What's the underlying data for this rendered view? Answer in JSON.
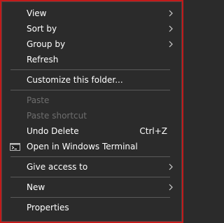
{
  "menu": {
    "view": "View",
    "sort_by": "Sort by",
    "group_by": "Group by",
    "refresh": "Refresh",
    "customize": "Customize this folder...",
    "paste": "Paste",
    "paste_shortcut": "Paste shortcut",
    "undo_delete": "Undo Delete",
    "undo_delete_shortcut": "Ctrl+Z",
    "open_terminal": "Open in Windows Terminal",
    "give_access": "Give access to",
    "new": "New",
    "properties": "Properties"
  },
  "icons": {
    "terminal": "terminal-icon",
    "submenu": "chevron-right-icon"
  },
  "colors": {
    "background": "#2b2b2b",
    "frame": "#c21a1a",
    "text": "#ffffff",
    "disabled_text": "#6e6e6e",
    "separator": "#5a5a5a"
  }
}
